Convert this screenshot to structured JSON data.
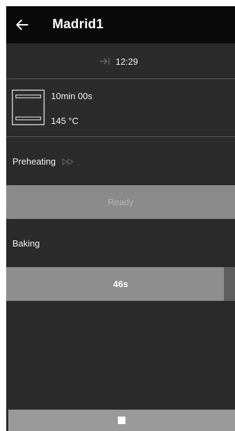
{
  "header": {
    "title": "Madrid1",
    "back_icon": "arrow-left-icon"
  },
  "timer": {
    "icon": "arrow-to-line-right-icon",
    "time": "12:29"
  },
  "program": {
    "oven_icon": "oven-icon",
    "duration": "10min 00s",
    "temperature": "145 °C"
  },
  "preheating": {
    "label": "Preheating",
    "icon": "fast-forward-outline-icon",
    "status": "Ready"
  },
  "baking": {
    "label": "Baking",
    "remaining": "46s",
    "progress": 0.95
  },
  "controls": {
    "stop_icon": "stop-icon"
  }
}
